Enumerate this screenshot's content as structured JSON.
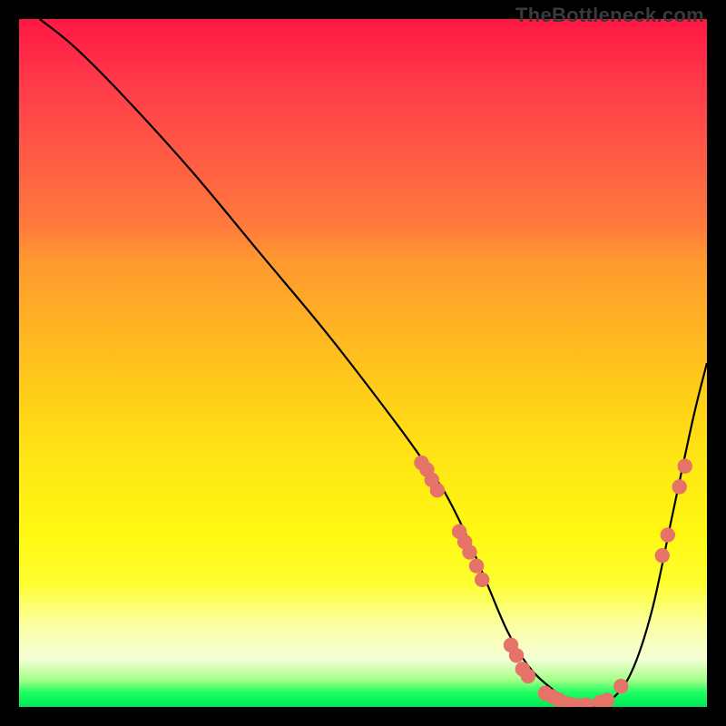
{
  "watermark": "TheBottleneck.com",
  "chart_data": {
    "type": "line",
    "title": "",
    "xlabel": "",
    "ylabel": "",
    "xlim": [
      0,
      100
    ],
    "ylim": [
      0,
      100
    ],
    "grid": false,
    "legend": false,
    "series": [
      {
        "name": "curve",
        "x": [
          3,
          8,
          15,
          25,
          35,
          45,
          55,
          60,
          62,
          65,
          68,
          71,
          74,
          77,
          80,
          83,
          86,
          89,
          92,
          95,
          98,
          100
        ],
        "y": [
          100,
          96,
          89,
          78,
          66,
          54,
          41,
          34,
          31,
          25,
          18,
          11,
          6,
          3,
          1,
          0,
          1,
          5,
          14,
          28,
          42,
          50
        ]
      }
    ],
    "markers": [
      {
        "x": 58.5,
        "y": 35.5
      },
      {
        "x": 59.3,
        "y": 34.5
      },
      {
        "x": 60.0,
        "y": 33.0
      },
      {
        "x": 60.8,
        "y": 31.5
      },
      {
        "x": 64.0,
        "y": 25.5
      },
      {
        "x": 64.8,
        "y": 24.0
      },
      {
        "x": 65.5,
        "y": 22.5
      },
      {
        "x": 66.5,
        "y": 20.5
      },
      {
        "x": 67.3,
        "y": 18.5
      },
      {
        "x": 71.5,
        "y": 9.0
      },
      {
        "x": 72.3,
        "y": 7.5
      },
      {
        "x": 73.2,
        "y": 5.5
      },
      {
        "x": 74.0,
        "y": 4.5
      },
      {
        "x": 76.5,
        "y": 2.0
      },
      {
        "x": 77.5,
        "y": 1.5
      },
      {
        "x": 78.5,
        "y": 1.0
      },
      {
        "x": 79.5,
        "y": 0.5
      },
      {
        "x": 80.5,
        "y": 0.3
      },
      {
        "x": 81.5,
        "y": 0.2
      },
      {
        "x": 82.5,
        "y": 0.3
      },
      {
        "x": 84.5,
        "y": 0.7
      },
      {
        "x": 85.5,
        "y": 1.0
      },
      {
        "x": 87.5,
        "y": 3.0
      },
      {
        "x": 93.5,
        "y": 22.0
      },
      {
        "x": 94.3,
        "y": 25.0
      },
      {
        "x": 96.0,
        "y": 32.0
      },
      {
        "x": 96.8,
        "y": 35.0
      }
    ],
    "colors": {
      "curve": "#000000",
      "marker_fill": "#e57368",
      "marker_stroke": "#d85c52"
    }
  }
}
